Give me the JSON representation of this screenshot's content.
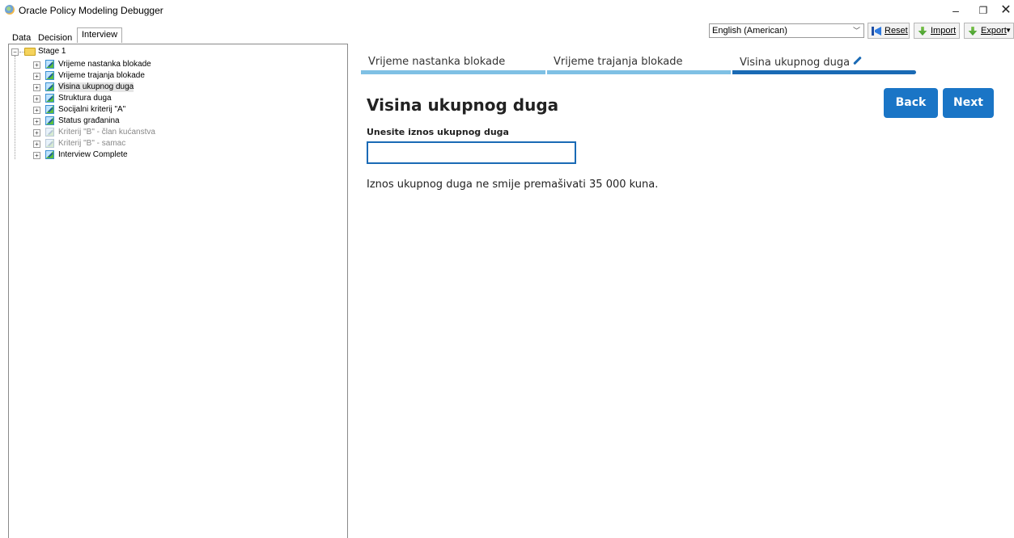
{
  "window": {
    "title": "Oracle Policy Modeling Debugger",
    "minimize_glyph": "–",
    "maximize_glyph": "❐",
    "close_glyph": "✕"
  },
  "tabs": [
    {
      "label": "Data"
    },
    {
      "label": "Decision"
    },
    {
      "label": "Interview"
    }
  ],
  "toolbar": {
    "language": "English (American)",
    "reset_label": "Reset",
    "import_label": "Import",
    "export_label": "Export"
  },
  "tree": {
    "root_label": "Stage 1",
    "items": [
      {
        "label": "Vrijeme nastanka blokade",
        "state": "normal"
      },
      {
        "label": "Vrijeme trajanja blokade",
        "state": "normal"
      },
      {
        "label": "Visina ukupnog duga",
        "state": "selected"
      },
      {
        "label": "Struktura duga",
        "state": "normal"
      },
      {
        "label": "Socijalni kriterij \"A\"",
        "state": "normal"
      },
      {
        "label": "Status građanina",
        "state": "normal"
      },
      {
        "label": "Kriterij \"B\" - član kućanstva",
        "state": "disabled"
      },
      {
        "label": "Kriterij \"B\" - samac",
        "state": "disabled"
      },
      {
        "label": "Interview Complete",
        "state": "normal"
      }
    ]
  },
  "progress": {
    "steps": [
      {
        "label": "Vrijeme nastanka blokade",
        "status": "done"
      },
      {
        "label": "Vrijeme trajanja blokade",
        "status": "done"
      },
      {
        "label": "Visina ukupnog duga",
        "status": "current"
      }
    ]
  },
  "page": {
    "heading": "Visina ukupnog duga",
    "back_label": "Back",
    "next_label": "Next",
    "field_label": "Unesite iznos ukupnog duga",
    "field_value": "",
    "note": "Iznos ukupnog duga ne smije premašivati 35 000 kuna."
  },
  "colors": {
    "accent": "#1a75c6",
    "progress_done": "#7fc0e4",
    "progress_current": "#1a6ab5"
  }
}
